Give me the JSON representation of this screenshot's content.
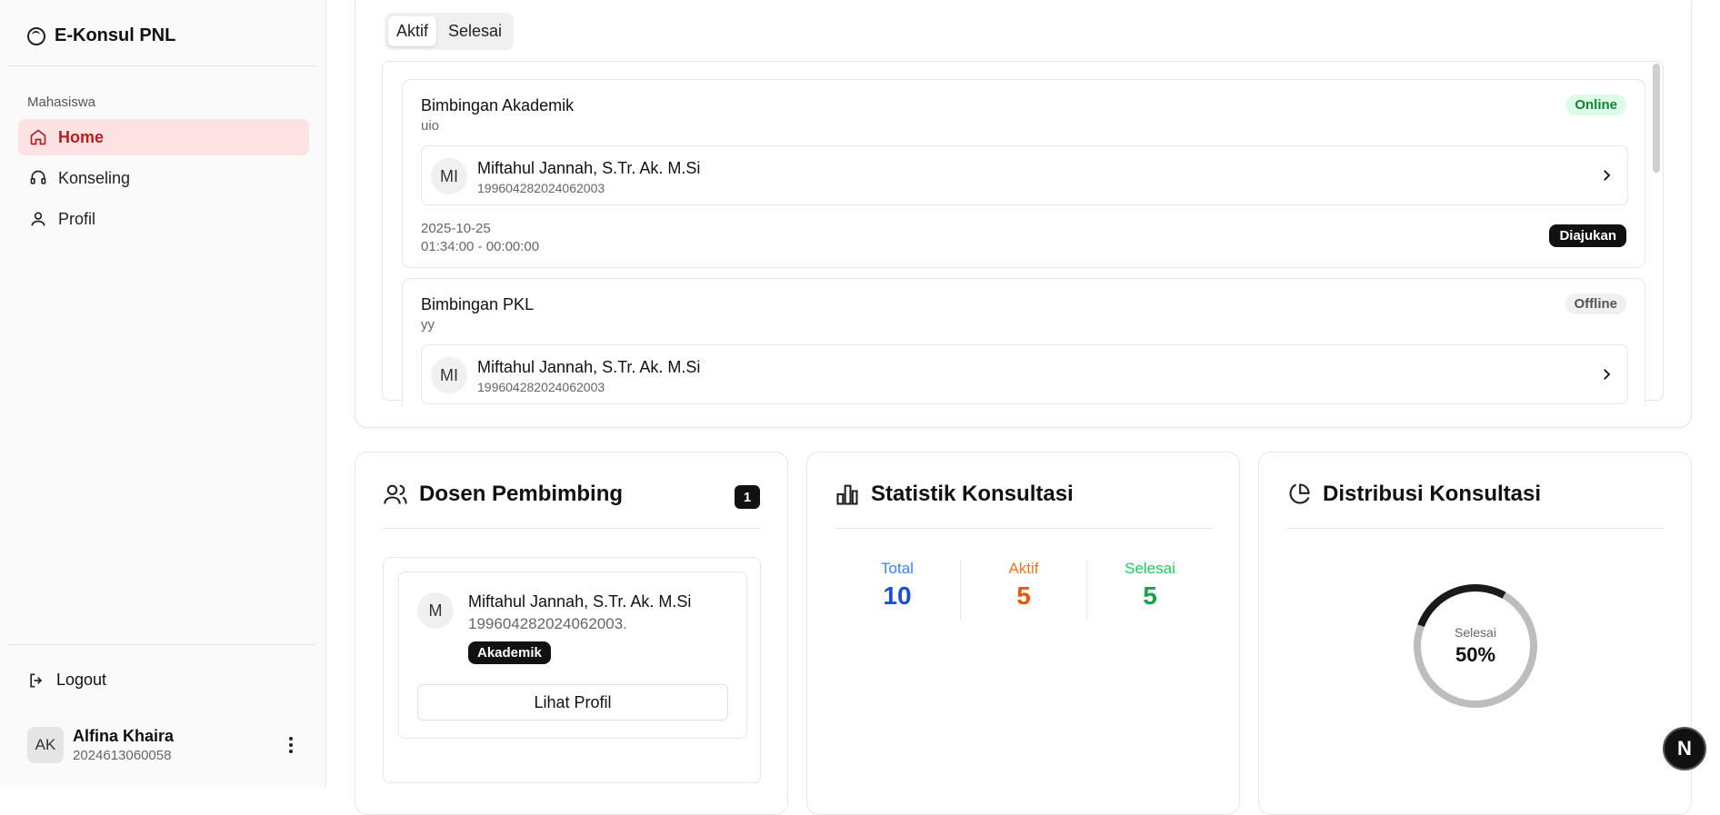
{
  "app": {
    "brand": "E-Konsul PNL"
  },
  "sidebar": {
    "group_label": "Mahasiswa",
    "items": [
      {
        "label": "Home",
        "icon": "home-icon",
        "active": true
      },
      {
        "label": "Konseling",
        "icon": "headset-icon",
        "active": false
      },
      {
        "label": "Profil",
        "icon": "user-icon",
        "active": false
      }
    ],
    "logout": "Logout",
    "user": {
      "initials": "AK",
      "name": "Alfina Khaira",
      "nim": "2024613060058"
    }
  },
  "tabs": [
    {
      "label": "Aktif"
    },
    {
      "label": "Selesai"
    }
  ],
  "consultations": [
    {
      "title": "Bimbingan Akademik",
      "subtitle": "uio",
      "mode": "Online",
      "lecturer": {
        "initials": "MI",
        "name": "Miftahul Jannah, S.Tr. Ak. M.Si",
        "id": "199604282024062003"
      },
      "date": "2025-10-25",
      "time": "01:34:00 - 00:00:00",
      "status": "Diajukan"
    },
    {
      "title": "Bimbingan PKL",
      "subtitle": "yy",
      "mode": "Offline",
      "lecturer": {
        "initials": "MI",
        "name": "Miftahul Jannah, S.Tr. Ak. M.Si",
        "id": "199604282024062003"
      }
    }
  ],
  "supervisor_card": {
    "title": "Dosen Pembimbing",
    "count": "1",
    "lecturer": {
      "initials": "M",
      "name": "Miftahul Jannah, S.Tr. Ak. M.Si",
      "id": "199604282024062003.",
      "tag": "Akademik"
    },
    "button": "Lihat Profil"
  },
  "stats_card": {
    "title": "Statistik Konsultasi",
    "items": [
      {
        "label": "Total",
        "value": "10",
        "label_color": "#3b82f6",
        "value_color": "#1d4ed8"
      },
      {
        "label": "Aktif",
        "value": "5",
        "label_color": "#f97316",
        "value_color": "#ea580c"
      },
      {
        "label": "Selesai",
        "value": "5",
        "label_color": "#22c55e",
        "value_color": "#16a34a"
      }
    ]
  },
  "distribution_card": {
    "title": "Distribusi Konsultasi",
    "center_label": "Selesai",
    "center_value": "50%",
    "completed_fraction": 0.5
  },
  "colors": {
    "accent": "#b91c1c",
    "accent_bg": "#fde2e4"
  }
}
